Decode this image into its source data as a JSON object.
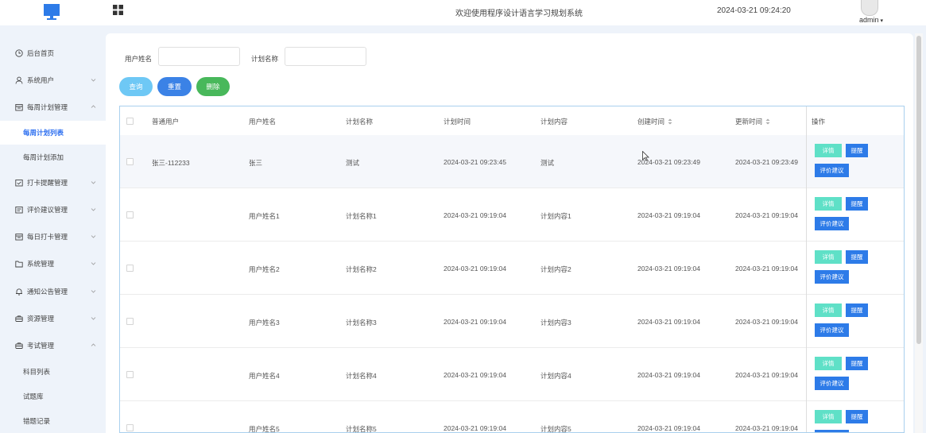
{
  "header": {
    "title": "欢迎使用程序设计语言学习规划系统",
    "datetime": "2024-03-21 09:24:20",
    "user": "admin",
    "icons": [
      "monitor-icon",
      "grid-menu-icon",
      "avatar",
      "caret-down-icon"
    ]
  },
  "sidebar": {
    "items": [
      {
        "label": "后台首页",
        "icon": "clock-icon"
      },
      {
        "label": "系统用户",
        "icon": "user-icon"
      },
      {
        "label": "每周计划管理",
        "icon": "calendar-icon"
      },
      {
        "label": "每周计划列表"
      },
      {
        "label": "每周计划添加"
      },
      {
        "label": "打卡提醒管理",
        "icon": "check-icon"
      },
      {
        "label": "评价建议管理",
        "icon": "comment-icon"
      },
      {
        "label": "每日打卡管理",
        "icon": "calendar-icon"
      },
      {
        "label": "系统管理",
        "icon": "folder-icon"
      },
      {
        "label": "通知公告管理",
        "icon": "bell-icon"
      },
      {
        "label": "资源管理",
        "icon": "briefcase-icon"
      },
      {
        "label": "考试管理",
        "icon": "briefcase-icon"
      },
      {
        "label": "科目列表"
      },
      {
        "label": "试题库"
      },
      {
        "label": "错题记录"
      }
    ]
  },
  "filters": {
    "user_name_label": "用户姓名",
    "user_name_value": "",
    "plan_name_label": "计划名称",
    "plan_name_value": ""
  },
  "actions": {
    "query": "查询",
    "reset": "重置",
    "delete": "删除"
  },
  "table": {
    "columns": [
      "普通用户",
      "用户姓名",
      "计划名称",
      "计划时间",
      "计划内容",
      "创建时间",
      "更新时间",
      "操作"
    ],
    "op_labels": {
      "detail": "详情",
      "remind": "提醒",
      "evaluate": "评价建议"
    },
    "rows": [
      {
        "user": "张三-112233",
        "name": "张三",
        "plan": "测试",
        "plan_time": "2024-03-21 09:23:45",
        "content": "测试",
        "created": "2024-03-21 09:23:49",
        "updated": "2024-03-21 09:23:49"
      },
      {
        "user": "",
        "name": "用户姓名1",
        "plan": "计划名称1",
        "plan_time": "2024-03-21 09:19:04",
        "content": "计划内容1",
        "created": "2024-03-21 09:19:04",
        "updated": "2024-03-21 09:19:04"
      },
      {
        "user": "",
        "name": "用户姓名2",
        "plan": "计划名称2",
        "plan_time": "2024-03-21 09:19:04",
        "content": "计划内容2",
        "created": "2024-03-21 09:19:04",
        "updated": "2024-03-21 09:19:04"
      },
      {
        "user": "",
        "name": "用户姓名3",
        "plan": "计划名称3",
        "plan_time": "2024-03-21 09:19:04",
        "content": "计划内容3",
        "created": "2024-03-21 09:19:04",
        "updated": "2024-03-21 09:19:04"
      },
      {
        "user": "",
        "name": "用户姓名4",
        "plan": "计划名称4",
        "plan_time": "2024-03-21 09:19:04",
        "content": "计划内容4",
        "created": "2024-03-21 09:19:04",
        "updated": "2024-03-21 09:19:04"
      },
      {
        "user": "",
        "name": "用户姓名5",
        "plan": "计划名称5",
        "plan_time": "2024-03-21 09:19:04",
        "content": "计划内容5",
        "created": "2024-03-21 09:19:04",
        "updated": "2024-03-21 09:19:04"
      }
    ]
  },
  "colors": {
    "accent": "#2d7be8",
    "query_button": "#6ec8f5",
    "reset_button": "#3b82e6",
    "delete_button": "#48b85b",
    "detail_button": "#5fe0c7",
    "active_menu_text": "#2d6ff0"
  }
}
